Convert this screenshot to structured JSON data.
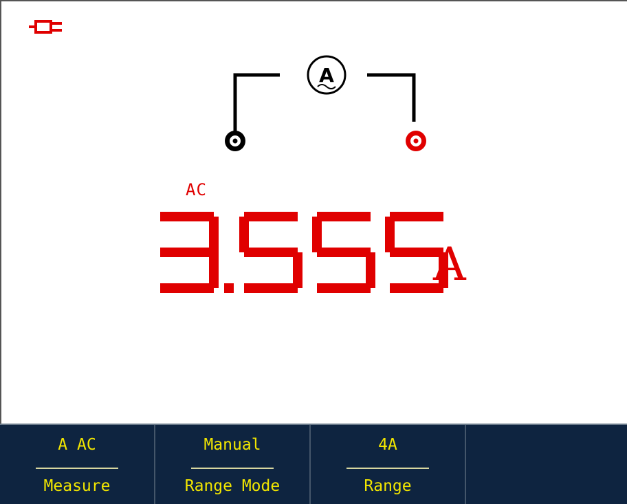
{
  "meter": {
    "coupling": "AC",
    "reading": "3.555",
    "unit": "A"
  },
  "probe": {
    "symbol": "A",
    "icons": [
      "power-plug-icon",
      "ammeter-clamp-icon",
      "com-terminal-icon",
      "input-terminal-icon"
    ]
  },
  "colors": {
    "reading": "#e00000",
    "softkey_bg": "#0e2440",
    "softkey_text": "#f2e600"
  },
  "softkeys": [
    {
      "top": "A AC",
      "bottom": "Measure"
    },
    {
      "top": "Manual",
      "bottom": "Range Mode"
    },
    {
      "top": "4A",
      "bottom": "Range"
    }
  ]
}
